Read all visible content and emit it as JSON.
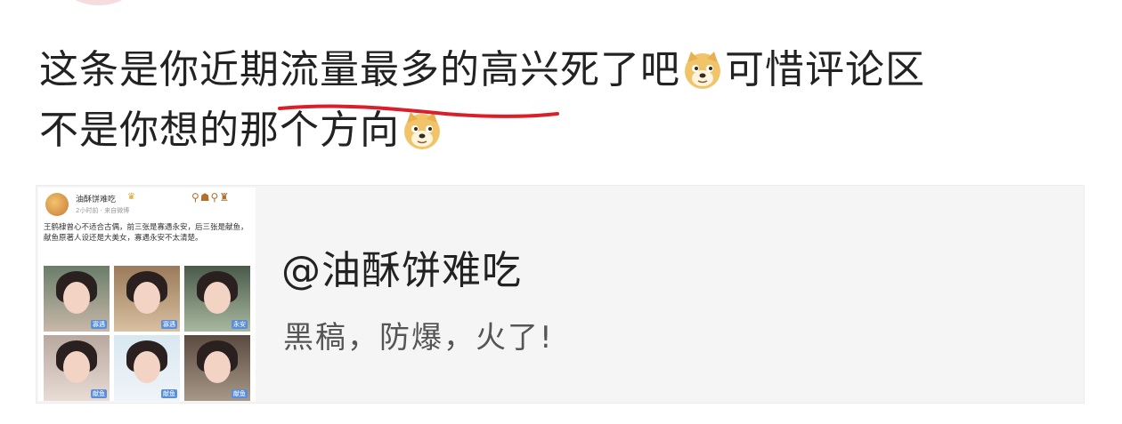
{
  "post": {
    "line1_prefix": "这条是你近期流量最多的高兴死了吧",
    "line1_suffix": "可惜评论区",
    "line2_text": "不是你想的那个方向",
    "emoji_name": "doge-emoji"
  },
  "highlight": {
    "color": "#d9202a"
  },
  "card": {
    "title": "@油酥饼难吃",
    "subtitle": "黑稿，防爆，火了!",
    "thumbnail": {
      "author": "油酥饼难吃",
      "crown": "♛",
      "time": "2小时前 · 来自微博",
      "badges": "⚲☗⚲♜",
      "text": "王鹤棣曾心不适合古偶，前三张是寡遇永安，后三张是献鱼，献鱼原著人设还是大美女，寡遇永安不太清楚。",
      "tags": [
        "寡遇",
        "寡遇",
        "永安",
        "献鱼",
        "献鱼",
        "献鱼"
      ]
    }
  },
  "colors": {
    "background": "#ffffff",
    "card_bg": "#f5f5f5",
    "text": "#222222",
    "subtext": "#555555"
  }
}
